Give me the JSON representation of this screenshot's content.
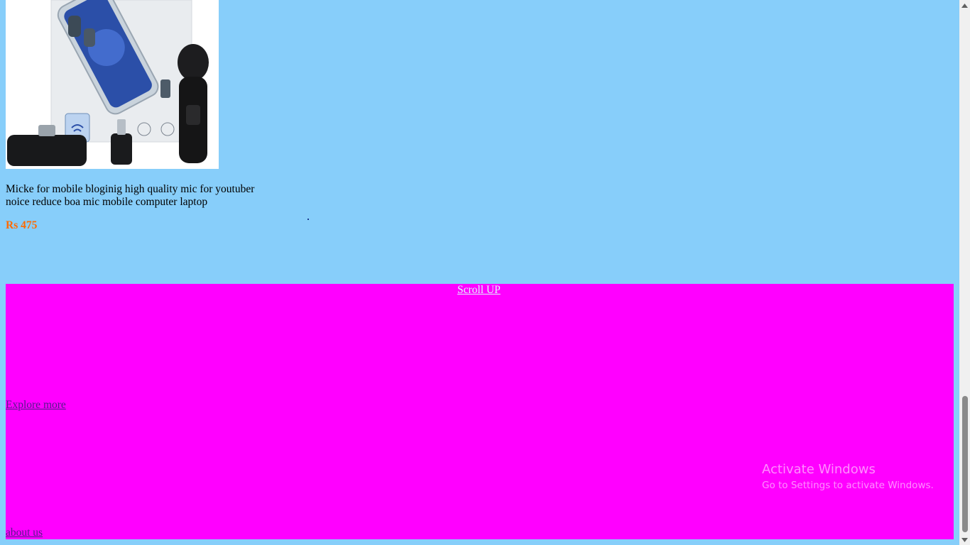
{
  "product": {
    "image_alt": "Wireless lavalier microphone set with phone",
    "title": "Micke for mobile bloginig high quality mic for youtuber noice reduce boa mic mobile computer laptop",
    "price": "Rs 475"
  },
  "footer": {
    "scroll_up": "Scroll UP",
    "explore_more": "Explore more",
    "about_us": "about us"
  },
  "watermark": {
    "title": "Activate Windows",
    "subtitle": "Go to Settings to activate Windows."
  },
  "colors": {
    "page_background": "#87cefa",
    "footer_background": "#ff00ff",
    "price": "#ff6a00",
    "visited_link": "#551a8b"
  },
  "icons": {
    "scroll_up_arrow": "triangle-up",
    "scroll_down_arrow": "triangle-down"
  }
}
